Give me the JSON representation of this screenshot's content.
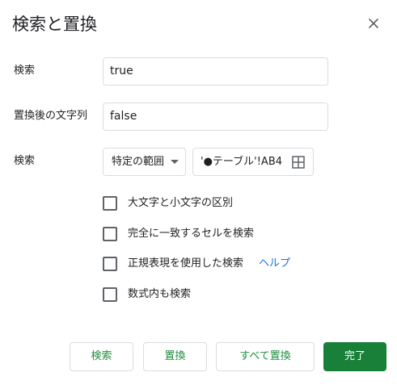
{
  "dialog": {
    "title": "検索と置換"
  },
  "find": {
    "label": "検索",
    "value": "true"
  },
  "replace": {
    "label": "置換後の文字列",
    "value": "false"
  },
  "scope": {
    "label": "検索",
    "selected": "特定の範囲",
    "range_value": "'●テーブル'!AB4"
  },
  "options": [
    {
      "label": "大文字と小文字の区別",
      "checked": false
    },
    {
      "label": "完全に一致するセルを検索",
      "checked": false
    },
    {
      "label": "正規表現を使用した検索",
      "checked": false
    },
    {
      "label": "数式内も検索",
      "checked": false
    }
  ],
  "help_link": "ヘルプ",
  "buttons": {
    "find": "検索",
    "replace": "置換",
    "replace_all": "すべて置換",
    "done": "完了"
  },
  "colors": {
    "accent_green": "#188038",
    "link_blue": "#1a73e8",
    "border": "#dadce0"
  }
}
